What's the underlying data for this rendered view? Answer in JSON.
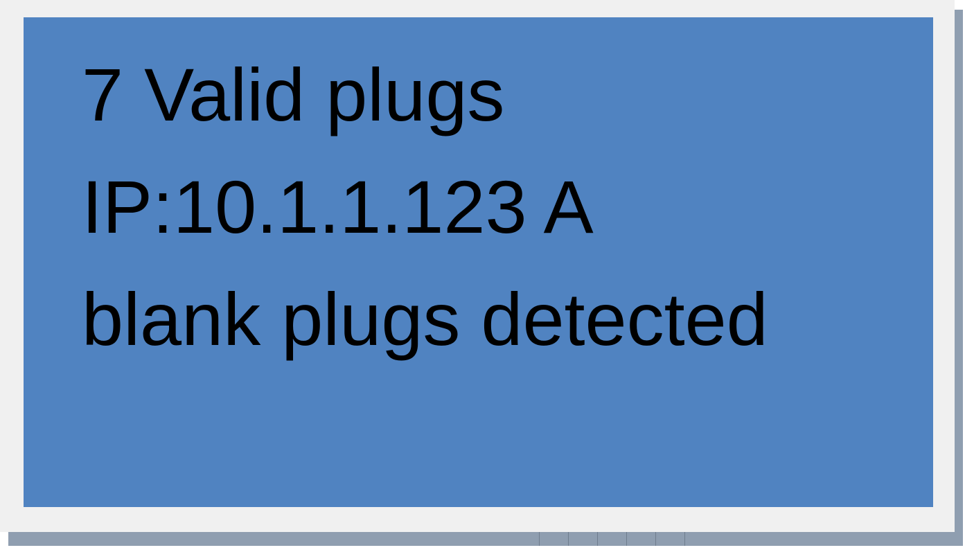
{
  "display": {
    "lines": [
      "7 Valid plugs",
      "IP:10.1.1.123 A",
      "blank plugs detected"
    ],
    "colors": {
      "screen_background": "#5083c1",
      "text": "#000000",
      "bezel": "#f0f0f0",
      "shadow": "#8f9eb0"
    }
  }
}
